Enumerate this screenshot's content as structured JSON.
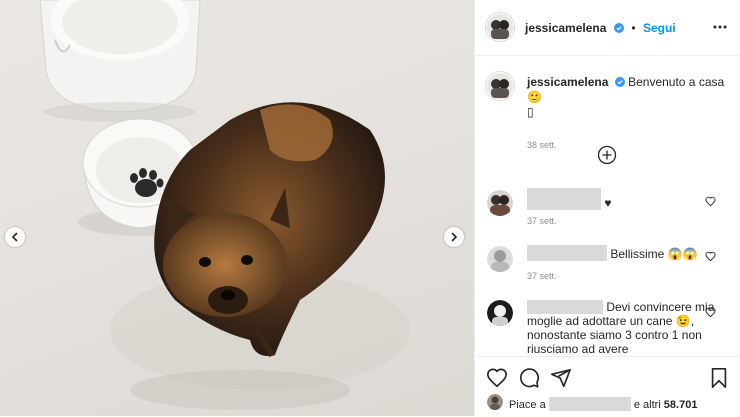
{
  "post": {
    "username": "jessicamelena",
    "follow_label": "Segui",
    "separator": "•",
    "caption_text": "Benvenuto a casa 🙂",
    "caption_text_line2": "▯",
    "caption_time": "38 sett."
  },
  "comments": [
    {
      "text": "♥",
      "time": "37 sett."
    },
    {
      "text": "Bellissime 😱😱",
      "time": "37 sett."
    },
    {
      "text": "Devi convincere mia moglie ad adottare un cane 😉, nonostante siamo 3 contro 1 non riusciamo ad avere"
    }
  ],
  "likes": {
    "prefix": "Piace a",
    "suffix": "e altri",
    "count": "58.701"
  },
  "icons": [
    "chevron-left-icon",
    "chevron-right-icon",
    "more-icon",
    "verified-icon",
    "add-comment-icon",
    "heart-icon",
    "comment-icon",
    "share-icon",
    "bookmark-icon"
  ],
  "colors": {
    "link": "#0095f6",
    "muted": "#8e8e8e",
    "verified": "#3897f0"
  }
}
